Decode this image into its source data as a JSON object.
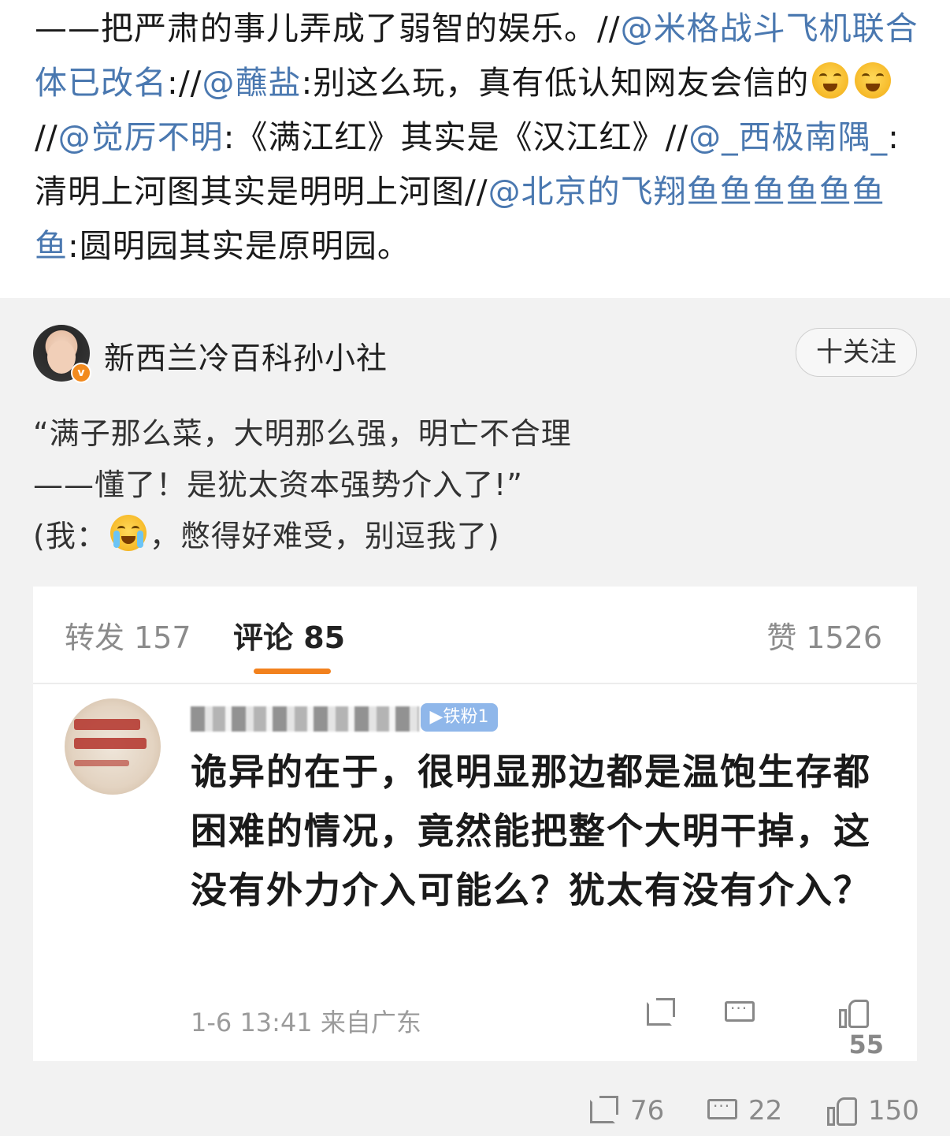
{
  "repost": {
    "t1": "——把严肃的事儿弄成了弱智的娱乐。//",
    "l1": "@米格战斗飞机联合体已改名",
    "t2": "://",
    "l2": "@蘸盐",
    "t3": ":别这么玩，真有低认知网友会信的",
    "emoji1": "laugh-cry-emoji",
    "t4": "//",
    "l3": "@觉厉不明",
    "t5": ":《满江红》其实是《汉江红》//",
    "l4": "@_西极南隅_",
    "t6": ":清明上河图其实是明明上河图//",
    "l5": "@北京的飞翔鱼鱼鱼鱼鱼鱼鱼",
    "t7": ":圆明园其实是原明园。"
  },
  "post": {
    "author": "新西兰冷百科孙小社",
    "follow_label": "十关注",
    "line1": "“满子那么菜，大明那么强，明亡不合理",
    "line2": "——懂了！是犹太资本强势介入了!”",
    "line3_a": "(我：",
    "line3_b": "，憋得好难受，别逗我了)"
  },
  "tabs": {
    "repost": "转发 157",
    "comments": "评论 85",
    "likes": "赞 1526"
  },
  "comment": {
    "badge": "铁粉1",
    "text": "诡异的在于，很明显那边都是温饱生存都困难的情况，竟然能把整个大明干掉，这没有外力介入可能么？犹太有没有介入？",
    "meta": "1-6 13:41 来自广东",
    "like_count": "55"
  },
  "bottom": {
    "share_count": "76",
    "comment_count": "22",
    "like_count": "150"
  },
  "colors": {
    "link": "#4a78b0",
    "accent": "#f2811d",
    "badge": "#8fb7ea"
  }
}
